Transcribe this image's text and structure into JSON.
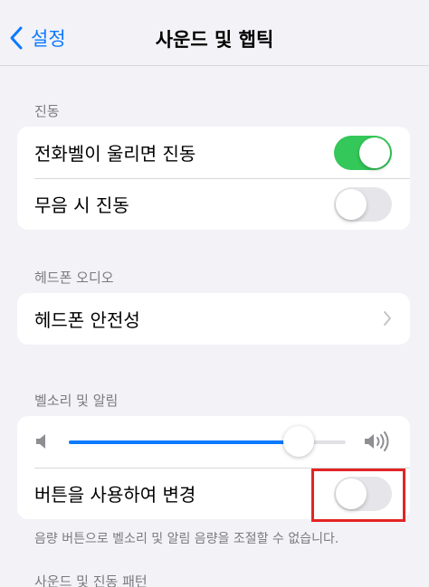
{
  "nav": {
    "back_label": "설정",
    "title": "사운드 및 햅틱"
  },
  "vibration": {
    "header": "진동",
    "items": [
      {
        "label": "전화벨이 울리면 진동",
        "on": true
      },
      {
        "label": "무음 시 진동",
        "on": false
      }
    ]
  },
  "headphone_audio": {
    "header": "헤드폰 오디오",
    "items": [
      {
        "label": "헤드폰 안전성"
      }
    ]
  },
  "ringer_alerts": {
    "header": "벨소리 및 알림",
    "volume_level": 0.83,
    "change_with_buttons": {
      "label": "버튼을 사용하여 변경",
      "on": false
    },
    "footer": "음량 버튼으로 벨소리 및 알림 음량을 조절할 수 없습니다."
  },
  "next_section": {
    "header": "사운드 및 진동 패턴"
  },
  "colors": {
    "accent": "#0a7aff",
    "toggle_on": "#34c759",
    "highlight": "#e32424"
  },
  "icons": {
    "back": "chevron-left-icon",
    "disclosure": "chevron-right-icon",
    "volume_low": "speaker-low-icon",
    "volume_high": "speaker-high-icon"
  }
}
